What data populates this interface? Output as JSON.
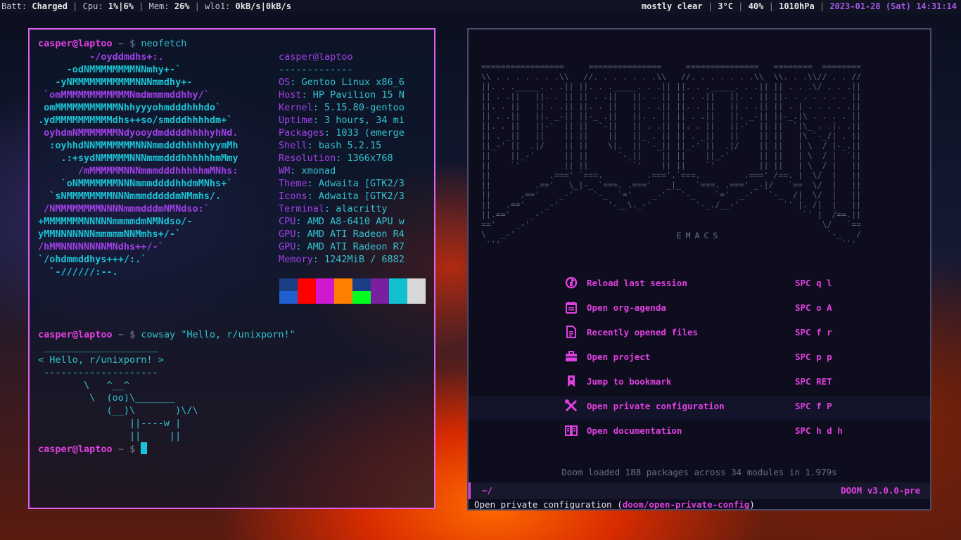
{
  "status_bar": {
    "batt_label": "Batt:",
    "batt_value": "Charged",
    "cpu_label": "Cpu:",
    "cpu_value": "1%|6%",
    "mem_label": "Mem:",
    "mem_value": "26%",
    "net_label": "wlo1:",
    "net_value": "0kB/s|0kB/s",
    "weather": "mostly clear",
    "temp": "3°C",
    "humidity": "40%",
    "pressure": "1010hPa",
    "date": "2023-01-28 (Sat) 14:31:14"
  },
  "terminal": {
    "prompt_user": "casper@laptoo",
    "prompt_tilde": "~ $",
    "cmd1": "neofetch",
    "cmd2": "cowsay \"Hello, r/unixporn!\"",
    "logo_lines": [
      "         -/oyddmdhs+:.",
      "     -odNMMMMMMMMNNmhy+-`",
      "   -yNMMMMMMMMMMMNNNmmdhy+-",
      " `omMMMMMMMMMMMMNmdmmmmddhhy/`",
      " omMMMMMMMMMMMNhhyyyohmdddhhhdo`",
      ".ydMMMMMMMMMMdhs++so/smdddhhhhdm+`",
      " oyhdmNMMMMMMMNdyooydmddddhhhhyhNd.",
      "  :oyhhdNNMMMMMMMNNNmmdddhhhhhyymMh",
      "    .:+sydNMMMMMNNNmmmdddhhhhhhmMmy",
      "       /mMMMMMMNNNmmmdddhhhhhmMNhs:",
      "    `oNMMMMMMMNNNmmmddddhhdmMNhs+`",
      "  `sNMMMMMMMMNNNmmmdddddmNMmhs/.",
      " /NMMMMMMMMNNNNmmmdddmNMNdso:`",
      "+MMMMMMMNNNNNmmmmdmNMNdso/-",
      "yMMNNNNNNNmmmmmNNMmhs+/-`",
      "/hMMNNNNNNNNMNdhs++/-`",
      "`/ohdmmddhys+++/:.`",
      "  `-//////:--."
    ],
    "info_title": "casper@laptoo",
    "info_divider": "-------------",
    "info": [
      {
        "k": "OS",
        "v": "Gentoo Linux x86_6"
      },
      {
        "k": "Host",
        "v": "HP Pavilion 15 N"
      },
      {
        "k": "Kernel",
        "v": "5.15.80-gentoo"
      },
      {
        "k": "Uptime",
        "v": "3 hours, 34 mi"
      },
      {
        "k": "Packages",
        "v": "1033 (emerge"
      },
      {
        "k": "Shell",
        "v": "bash 5.2.15"
      },
      {
        "k": "Resolution",
        "v": "1366x768"
      },
      {
        "k": "WM",
        "v": "xmonad"
      },
      {
        "k": "Theme",
        "v": "Adwaita [GTK2/3"
      },
      {
        "k": "Icons",
        "v": "Adwaita [GTK2/3"
      },
      {
        "k": "Terminal",
        "v": "alacritty"
      },
      {
        "k": "CPU",
        "v": "AMD A8-6410 APU w"
      },
      {
        "k": "GPU",
        "v": "AMD ATI Radeon R4"
      },
      {
        "k": "GPU",
        "v": "AMD ATI Radeon R7"
      },
      {
        "k": "Memory",
        "v": "1242MiB / 6882"
      }
    ],
    "swatch_colors": [
      "#1b3f86",
      "#ff0000",
      "#d018d0",
      "#ff8000",
      "#1b3f86",
      "#7a1fa0",
      "#10c0d0",
      "#d8d8d8",
      "#2060d0",
      "#ff0000",
      "#d018d0",
      "#ff8000",
      "#00ff20",
      "#7a1fa0",
      "#10c0d0",
      "#d8d8d8"
    ],
    "cow_lines": [
      " ____________________",
      "< Hello, r/unixporn! >",
      " --------------------",
      "        \\   ^__^",
      "         \\  (oo)\\_______",
      "            (__)\\       )\\/\\",
      "                ||----w |",
      "                ||     ||"
    ]
  },
  "emacs": {
    "splash_ascii": [
      "=================     ===============     ===============   ========  ========",
      "\\\\ . . . . . . .\\\\   //. . . . . . .\\\\   //. . . . . . .\\\\  \\\\. . .\\\\// . . //",
      "||. . ._____. . .|| ||. . ._____. . .|| ||. . ._____. . .|| || . . .\\/ . . .||",
      "|| . .||   ||. . || || . .||   ||. . || || . .||   ||. . || ||. . . . . . . ||",
      "||. . ||   || . .|| ||. . ||   || . .|| ||. . ||   || . .|| || . | . . . . .||",
      "|| . .||   ||. _-|| ||-_ .||   ||. . || || . .||   ||. _-|| ||-_.|\\ . . . . ||",
      "||. . ||   ||-'  || ||  `-||   || . .|| ||. . ||   ||-'  || ||  `|\\_ . .|. .||",
      "|| . _||   ||    || ||    ||   ||_ . || || . _||   ||    || ||   |\\ `-_/| . ||",
      "||_-' ||  .|/    || ||    \\|.  || `-_|| ||_-' ||  .|/    || ||   | \\  / |-_.||",
      "||    ||_-'      || ||      `-_||    || ||    ||_-'      || ||   | \\  / |  `||",
      "||    `'         || ||         `'    || ||    `'         || ||   | \\  / |   ||",
      "||            .===' `===.         .==='.`===.         .===' /==. |  \\/  |   ||",
      "||         .=='   \\_|-_ `===. .==='   _|_   `===. .===' _-|/   `==  \\/  |   ||",
      "||      .=='    _-'    `-_  `='    _-'   `-_    `='  _-'   `-_  /|  \\/  |   ||",
      "||   .=='    _-'          '-__\\._-'         '-_./__-'         `' |. /|  |   ||",
      "||.=='    _-'                                                     `' |  /==.||",
      "=='    _-'                                                            \\/   `==",
      "\\   _-'                                                                `-_   /",
      " `''                                                                      ``'"
    ],
    "splash_label": "EMACS",
    "menu": [
      {
        "icon": "reload-icon",
        "label": "Reload last session",
        "key": "SPC q l"
      },
      {
        "icon": "calendar-icon",
        "label": "Open org-agenda",
        "key": "SPC o A"
      },
      {
        "icon": "file-icon",
        "label": "Recently opened files",
        "key": "SPC f r"
      },
      {
        "icon": "briefcase-icon",
        "label": "Open project",
        "key": "SPC p p"
      },
      {
        "icon": "bookmark-icon",
        "label": "Jump to bookmark",
        "key": "SPC RET"
      },
      {
        "icon": "tools-icon",
        "label": "Open private configuration",
        "key": "SPC f P"
      },
      {
        "icon": "book-icon",
        "label": "Open documentation",
        "key": "SPC h d h"
      }
    ],
    "loaded_text": "Doom loaded 188 packages across 34 modules in 1.979s",
    "modeline_dir": "~/",
    "modeline_version": "DOOM v3.0.0-pre",
    "echo_text": "Open private configuration (",
    "echo_fn": "doom/open-private-config",
    "echo_close": ")"
  }
}
